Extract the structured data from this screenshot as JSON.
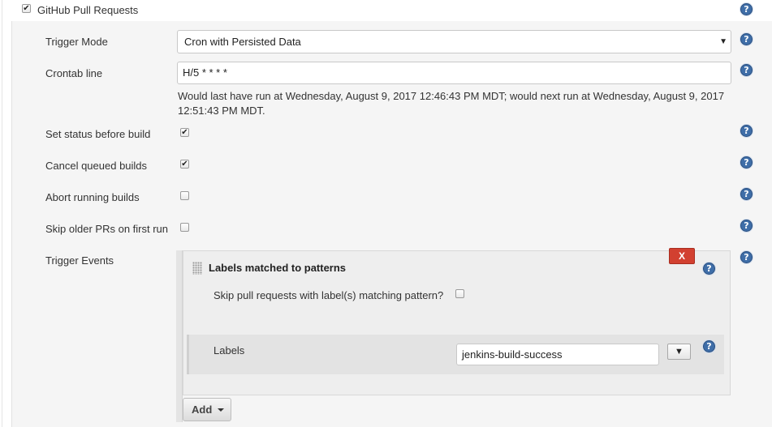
{
  "section": {
    "checkbox_checked": true,
    "title": "GitHub Pull Requests"
  },
  "fields": {
    "trigger_mode": {
      "label": "Trigger Mode",
      "value": "Cron with Persisted Data"
    },
    "crontab": {
      "label": "Crontab line",
      "value": "H/5 * * * *",
      "info_line1": "Would last have run at Wednesday, August 9, 2017 12:46:43 PM MDT; would next run at Wednesday, August 9, 2017",
      "info_line2": "12:51:43 PM MDT."
    },
    "set_status": {
      "label": "Set status before build",
      "checked": true
    },
    "cancel_queued": {
      "label": "Cancel queued builds",
      "checked": true
    },
    "abort_running": {
      "label": "Abort running builds",
      "checked": false
    },
    "skip_older": {
      "label": "Skip older PRs on first run",
      "checked": false
    },
    "trigger_events": {
      "label": "Trigger Events"
    }
  },
  "event": {
    "title": "Labels matched to patterns",
    "delete_label": "X",
    "skip_label": "Skip pull requests with label(s) matching pattern?",
    "skip_checked": false,
    "labels_label": "Labels",
    "labels_value": "jenkins-build-success",
    "labels_dropdown": "▼"
  },
  "add_button": {
    "label": "Add"
  },
  "glyphs": {
    "check": "✔",
    "help": "?",
    "select_arrow": "▼"
  },
  "colors": {
    "help_icon": "#3f6ea8",
    "delete_button": "#d24030",
    "panel_bg": "#f5f5f5"
  }
}
